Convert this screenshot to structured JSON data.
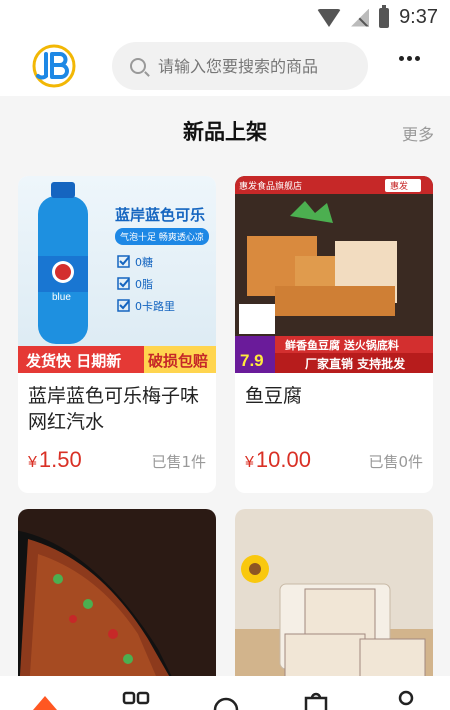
{
  "status": {
    "time": "9:37"
  },
  "search": {
    "placeholder": "请输入您要搜索的商品"
  },
  "section": {
    "title": "新品上架",
    "more": "更多"
  },
  "products": [
    {
      "name": "蓝岸蓝色可乐梅子味网红汽水",
      "price": "1.50",
      "sold": "已售1件",
      "image": {
        "heading": "蓝岸蓝色可乐",
        "tagline": "气泡十足 畅爽透心凉",
        "features": [
          "0糖",
          "0脂",
          "0卡路里"
        ],
        "bottle_label": "blue",
        "banner_left": "发货快 日期新",
        "banner_right": "破损包赔"
      }
    },
    {
      "name": "鱼豆腐",
      "price": "10.00",
      "sold": "已售0件",
      "image": {
        "shop": "惠发食品旗舰店",
        "brand": "惠发",
        "banner_top": "鲜香鱼豆腐 送火锅底料",
        "banner_bottom": "厂家直销 支持批发",
        "price_tag": "7.9"
      }
    }
  ],
  "currency": "¥"
}
